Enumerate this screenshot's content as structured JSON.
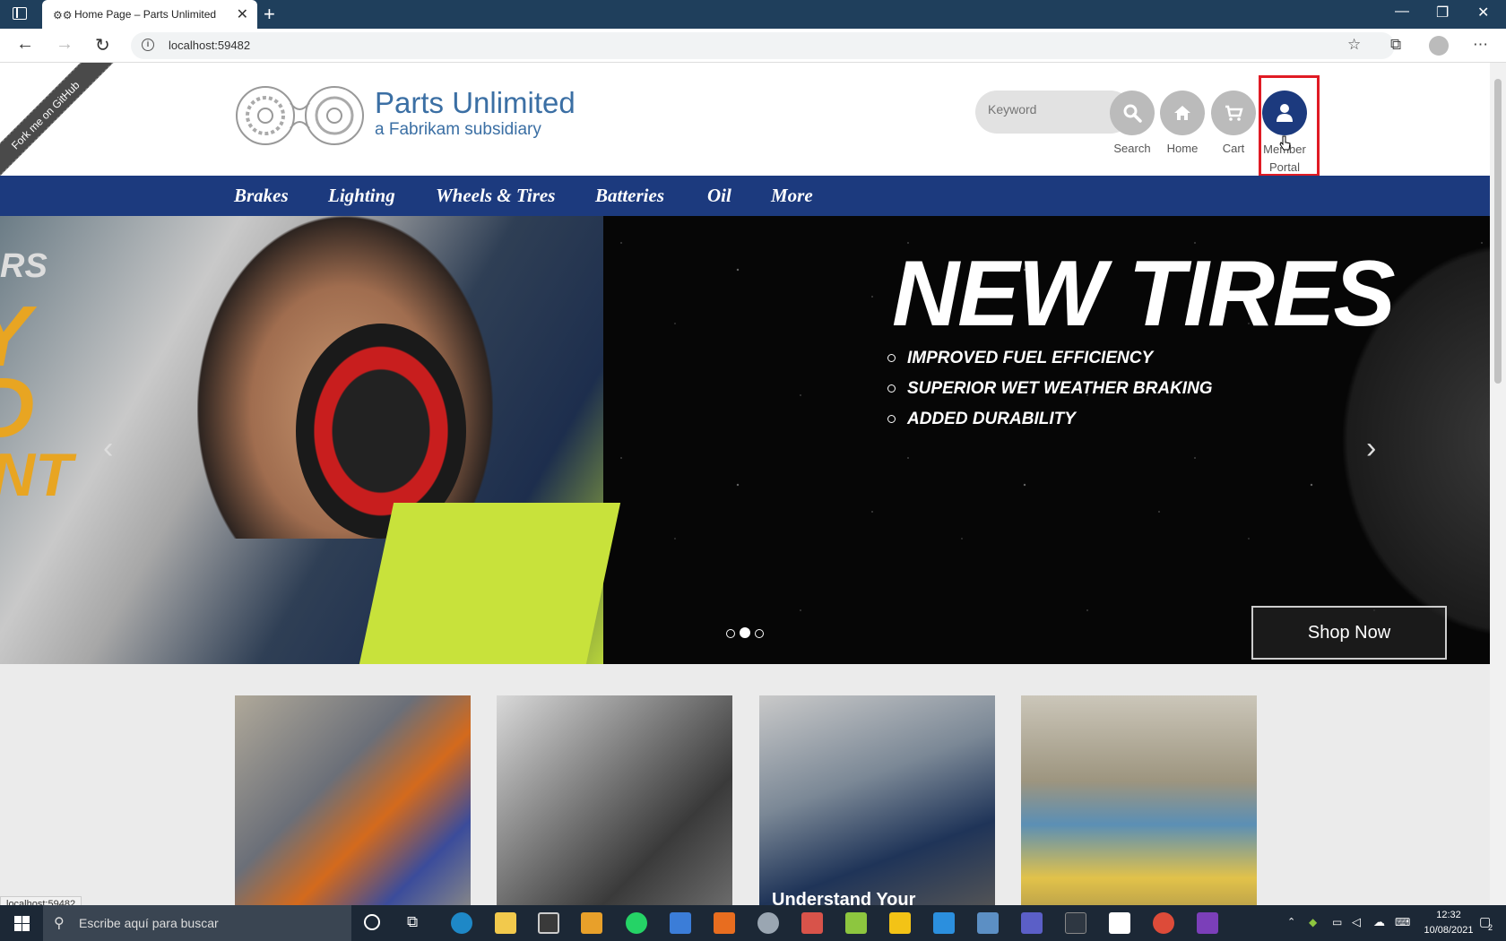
{
  "browser": {
    "tab_title": "Home Page – Parts Unlimited",
    "url": "localhost:59482",
    "status_url": "localhost:59482"
  },
  "site": {
    "ribbon": "Fork me on GitHub",
    "brand": "Parts Unlimited",
    "subbrand": "a Fabrikam subsidiary",
    "search_placeholder": "Keyword",
    "buttons": {
      "search": "Search",
      "home": "Home",
      "cart": "Cart",
      "member": "Member",
      "portal": "Portal"
    },
    "menu": [
      "Brakes",
      "Lighting",
      "Wheels & Tires",
      "Batteries",
      "Oil",
      "More"
    ]
  },
  "hero": {
    "side_text": [
      "RS",
      "Y",
      "D",
      "NT"
    ],
    "title": "NEW TIRES",
    "bullets": [
      "IMPROVED FUEL EFFICIENCY",
      "SUPERIOR WET WEATHER BRAKING",
      "ADDED DURABILITY"
    ],
    "cta": "Shop Now",
    "active_slide": 2,
    "slide_count": 3
  },
  "cards": {
    "caption_3": "Understand Your"
  },
  "taskbar": {
    "search_placeholder": "Escribe aquí para buscar",
    "time": "12:32",
    "date": "10/08/2021",
    "notifications": "2"
  },
  "colors": {
    "nav_bar": "#1c3a7e",
    "brand_blue": "#3b6fa4",
    "member_button": "#1c3a7e",
    "highlight": "#e01b24",
    "accent_orange": "#e8a522"
  }
}
